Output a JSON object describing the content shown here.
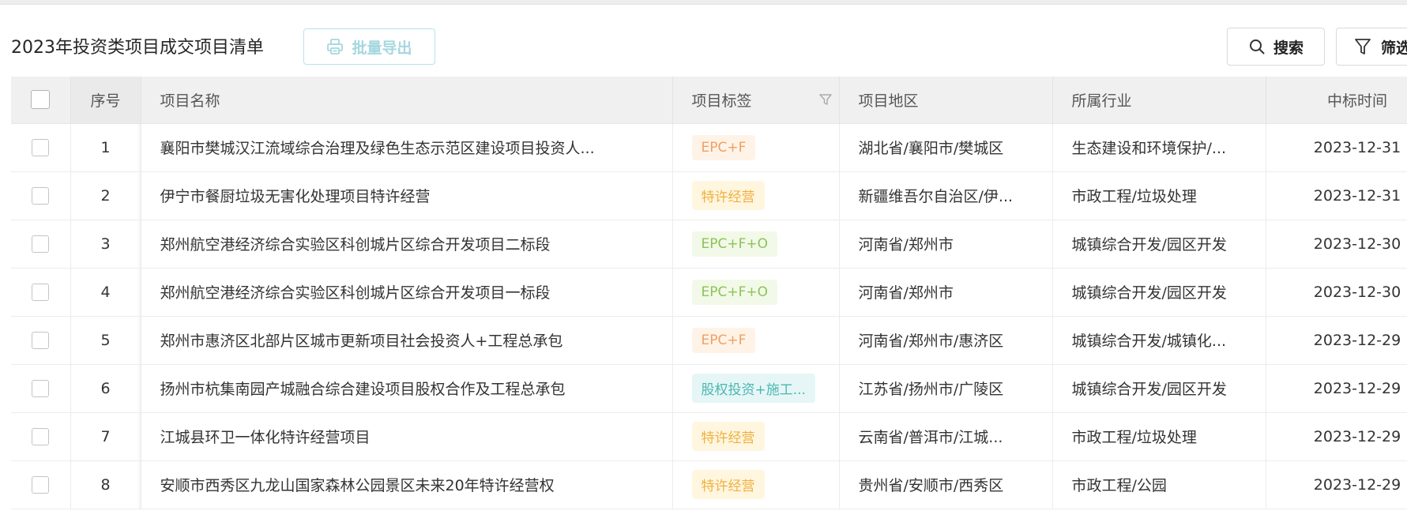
{
  "page": {
    "title": "2023年投资类项目成交项目清单",
    "export_label": "批量导出",
    "search_label": "搜索",
    "filter_label": "筛选"
  },
  "colors": {
    "tag_orange": "#f0a060",
    "tag_yellow": "#f0b040",
    "tag_green": "#8bc455",
    "tag_teal": "#4bb7b2",
    "header_bg": "#f0f0f0"
  },
  "table": {
    "columns": {
      "seq": "序号",
      "name": "项目名称",
      "tag": "项目标签",
      "region": "项目地区",
      "industry": "所属行业",
      "date": "中标时间"
    },
    "rows": [
      {
        "seq": "1",
        "name": "襄阳市樊城汉江流域综合治理及绿色生态示范区建设项目投资人...",
        "tag": "EPC+F",
        "tag_color": "orange",
        "region": "湖北省/襄阳市/樊城区",
        "industry": "生态建设和环境保护/...",
        "date": "2023-12-31"
      },
      {
        "seq": "2",
        "name": "伊宁市餐厨垃圾无害化处理项目特许经营",
        "tag": "特许经营",
        "tag_color": "yellow",
        "region": "新疆维吾尔自治区/伊...",
        "industry": "市政工程/垃圾处理",
        "date": "2023-12-31"
      },
      {
        "seq": "3",
        "name": "郑州航空港经济综合实验区科创城片区综合开发项目二标段",
        "tag": "EPC+F+O",
        "tag_color": "green",
        "region": "河南省/郑州市",
        "industry": "城镇综合开发/园区开发",
        "date": "2023-12-30"
      },
      {
        "seq": "4",
        "name": "郑州航空港经济综合实验区科创城片区综合开发项目一标段",
        "tag": "EPC+F+O",
        "tag_color": "green",
        "region": "河南省/郑州市",
        "industry": "城镇综合开发/园区开发",
        "date": "2023-12-30"
      },
      {
        "seq": "5",
        "name": "郑州市惠济区北部片区城市更新项目社会投资人+工程总承包",
        "tag": "EPC+F",
        "tag_color": "orange",
        "region": "河南省/郑州市/惠济区",
        "industry": "城镇综合开发/城镇化...",
        "date": "2023-12-29"
      },
      {
        "seq": "6",
        "name": "扬州市杭集南园产城融合综合建设项目股权合作及工程总承包",
        "tag": "股权投资+施工...",
        "tag_color": "teal",
        "region": "江苏省/扬州市/广陵区",
        "industry": "城镇综合开发/园区开发",
        "date": "2023-12-29"
      },
      {
        "seq": "7",
        "name": "江城县环卫一体化特许经营项目",
        "tag": "特许经营",
        "tag_color": "yellow",
        "region": "云南省/普洱市/江城...",
        "industry": "市政工程/垃圾处理",
        "date": "2023-12-29"
      },
      {
        "seq": "8",
        "name": "安顺市西秀区九龙山国家森林公园景区未来20年特许经营权",
        "tag": "特许经营",
        "tag_color": "yellow",
        "region": "贵州省/安顺市/西秀区",
        "industry": "市政工程/公园",
        "date": "2023-12-29"
      }
    ]
  }
}
